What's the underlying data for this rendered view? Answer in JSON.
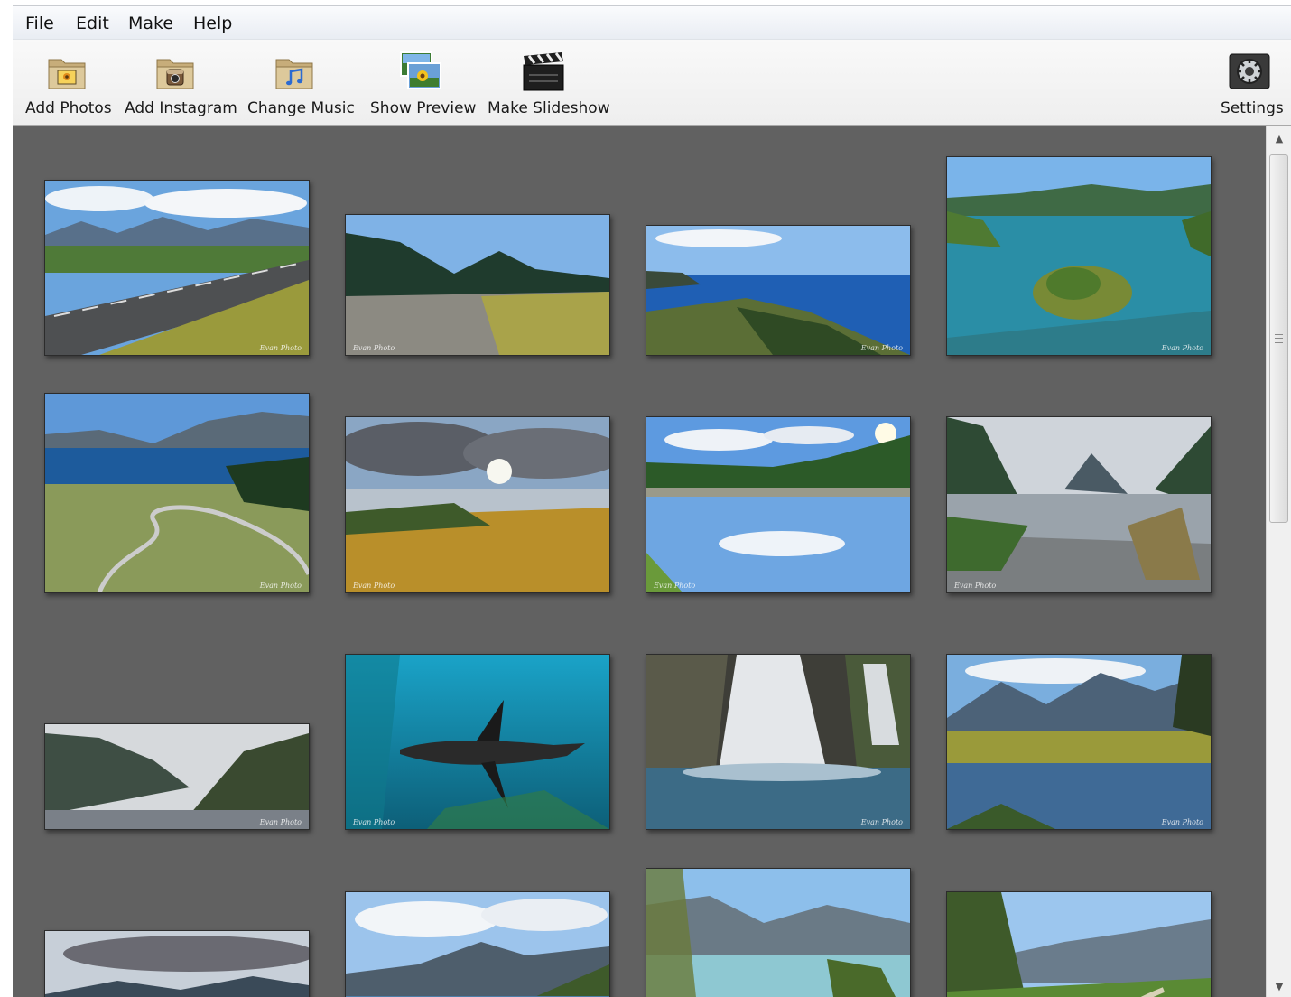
{
  "menu": [
    "File",
    "Edit",
    "Make",
    "Help"
  ],
  "toolbar": {
    "add_photos": "Add Photos",
    "add_instagram": "Add Instagram",
    "change_music": "Change Music",
    "show_preview": "Show Preview",
    "make_slideshow": "Make Slideshow",
    "settings": "Settings"
  },
  "icons": {
    "add_photos": "folder-photo-icon",
    "add_instagram": "folder-instagram-icon",
    "change_music": "folder-music-icon",
    "show_preview": "preview-photos-icon",
    "make_slideshow": "clapperboard-icon",
    "settings": "settings-icon"
  },
  "scrollbar": {
    "up": "▲",
    "down": "▼"
  },
  "photos": [
    {
      "scene": "road",
      "watermark": "Evan Photo"
    },
    {
      "scene": "riverbed",
      "watermark": "Evan Photo"
    },
    {
      "scene": "coast",
      "watermark": "Evan Photo"
    },
    {
      "scene": "lake-island",
      "watermark": "Evan Photo"
    },
    {
      "scene": "lake-road",
      "watermark": "Evan Photo"
    },
    {
      "scene": "cloudy-lake",
      "watermark": "Evan Photo"
    },
    {
      "scene": "river-reflection",
      "watermark": "Evan Photo"
    },
    {
      "scene": "fiord",
      "watermark": "Evan Photo"
    },
    {
      "scene": "sound",
      "watermark": "Evan Photo"
    },
    {
      "scene": "sea-lion",
      "watermark": "Evan Photo"
    },
    {
      "scene": "waterfall",
      "watermark": "Evan Photo"
    },
    {
      "scene": "mountain-wetland",
      "watermark": "Evan Photo"
    },
    {
      "scene": "sunset-hills",
      "watermark": ""
    },
    {
      "scene": "lake-mountains",
      "watermark": ""
    },
    {
      "scene": "glacial-river",
      "watermark": ""
    },
    {
      "scene": "trail",
      "watermark": ""
    }
  ]
}
